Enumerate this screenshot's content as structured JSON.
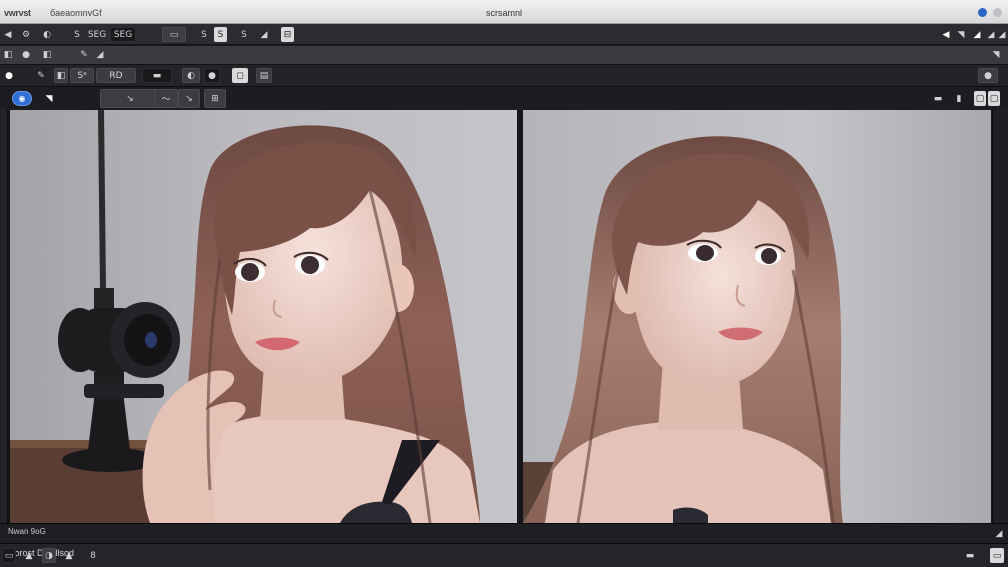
{
  "window": {
    "app_name": "vwrvst",
    "menu_name": "бaeaomnvGf",
    "title": "scrsamnl"
  },
  "toolbar1": {
    "items": [
      "◀",
      "⚙",
      "◐",
      "S",
      "SEG",
      "▭",
      "S",
      "S",
      "⊟"
    ],
    "right_items": [
      "◀",
      "◥",
      "◢",
      "◢",
      "◢"
    ]
  },
  "toolbar3": {
    "items": [
      "●",
      "✎",
      "◧",
      "Sᵃ",
      "RD",
      "▬",
      "◐",
      "●",
      "◻",
      "▤",
      "◻"
    ]
  },
  "toolbar4": {
    "select_label": "◉",
    "items": [
      "◥",
      "↘",
      "〜",
      "↘",
      "⊞"
    ],
    "right_items": [
      "▬",
      "▮",
      "▢"
    ]
  },
  "status": {
    "label": "Nwan 9oG"
  },
  "bottom": {
    "label": "Rorost Dntsllsod",
    "mark": "8",
    "icons": [
      "▭",
      "▲",
      "◑",
      "▲"
    ],
    "right_icons": [
      "▬",
      "▭"
    ]
  },
  "colors": {
    "accent": "#2f6fd6",
    "chrome_dark": "#1a1b1d",
    "titlebar": "#e4e5e7"
  }
}
